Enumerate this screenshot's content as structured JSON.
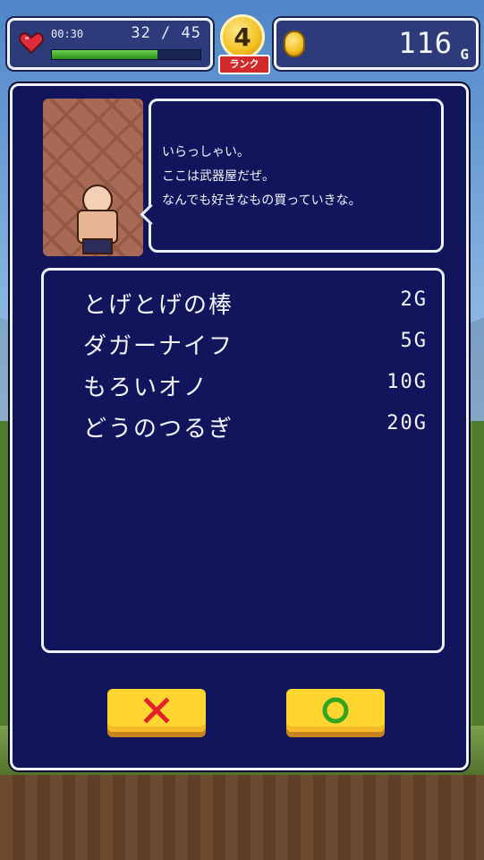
{
  "hud": {
    "time": "00:30",
    "hp": "32 / 45",
    "hp_fraction": 0.71,
    "rank": "4",
    "rank_label": "ランク",
    "gold": "116",
    "gold_unit": "G"
  },
  "shopkeeper": {
    "lines": [
      "いらっしゃい。",
      "ここは武器屋だぜ。",
      "なんでも好きなもの買っていきな。"
    ]
  },
  "items": [
    {
      "name": "とげとげの棒",
      "price": "2G"
    },
    {
      "name": "ダガーナイフ",
      "price": "5G"
    },
    {
      "name": "もろいオノ",
      "price": "10G"
    },
    {
      "name": "どうのつるぎ",
      "price": "20G"
    }
  ],
  "buttons": {
    "cancel_icon": "x-icon",
    "ok_icon": "circle-icon"
  },
  "colors": {
    "panel": "#10155c",
    "button": "#ffd630",
    "cancel": "#e3212a",
    "ok": "#2ea61f"
  }
}
